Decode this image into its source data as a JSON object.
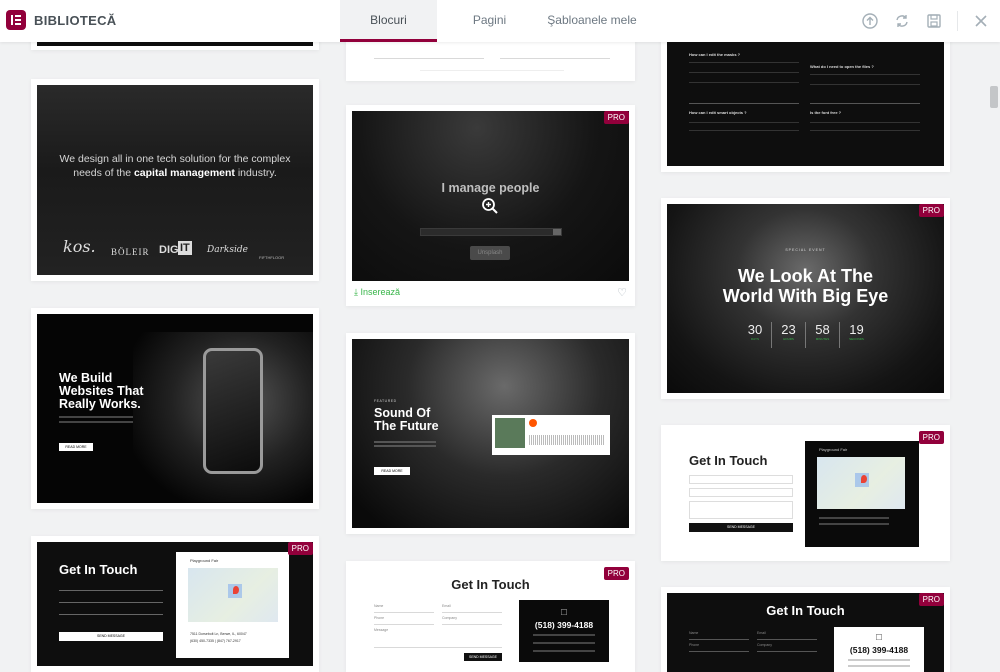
{
  "header": {
    "title": "BIBLIOTECĂ",
    "tabs": [
      {
        "label": "Blocuri",
        "active": true
      },
      {
        "label": "Pagini",
        "active": false
      },
      {
        "label": "Şabloanele mele",
        "active": false
      }
    ],
    "icons": [
      "upload-icon",
      "sync-icon",
      "save-icon",
      "close-icon"
    ]
  },
  "colors": {
    "accent": "#92003b",
    "insert": "#39b54a",
    "background": "#f1f2f3"
  },
  "cards": {
    "tech": {
      "headline_1": "We design all in one tech solution for the complex",
      "headline_2_pre": "needs of the ",
      "headline_2_bold": "capital management",
      "headline_2_post": " industry.",
      "logos": [
        "kos.",
        "BÖLEIR",
        "DIG",
        "IT",
        "Darkside",
        "FIFTHFLOOR"
      ]
    },
    "manage": {
      "title": "I manage people",
      "badge": "PRO",
      "insert_label": "Inserează",
      "watermark": "Unsplash"
    },
    "faq": {
      "questions": [
        "How can I edit the masks ?",
        "What do I need to open the files ?",
        "How can I edit smart objects ?",
        "Is the font free ?"
      ]
    },
    "phone": {
      "title_lines": [
        "We Build",
        "Websites That",
        "Really Works."
      ],
      "button": "READ MORE"
    },
    "future": {
      "eyebrow": "FEATURED",
      "title_lines": [
        "Sound Of",
        "The Future"
      ],
      "button": "READ MORE"
    },
    "event": {
      "badge": "PRO",
      "eyebrow": "SPECIAL EVENT",
      "title_lines": [
        "We Look At The",
        "World With Big Eye"
      ],
      "countdown": [
        {
          "value": "30",
          "unit": "DAYS"
        },
        {
          "value": "23",
          "unit": "HOURS"
        },
        {
          "value": "58",
          "unit": "MINUTES"
        },
        {
          "value": "19",
          "unit": "SECONDS"
        }
      ]
    },
    "contact_white_right": {
      "badge": "PRO",
      "title": "Get In Touch",
      "button": "SEND MESSAGE",
      "map_label": "Playground Fair"
    },
    "contact_dark_left": {
      "badge": "PRO",
      "title": "Get In Touch",
      "button": "SEND MESSAGE",
      "map_label": "Playground Fair",
      "address": "7511 Dorsebolt Ln, Berwe, IL, 60047",
      "phone": "(630) 450-7335 | (847) 767-2917"
    },
    "contact_white_mid": {
      "badge": "PRO",
      "title": "Get In Touch",
      "phone": "(518) 399-4188",
      "button": "SEND MESSAGE",
      "fields": [
        "Name",
        "Email",
        "Phone",
        "Company",
        "Message"
      ]
    },
    "contact_dark_right": {
      "badge": "PRO",
      "title": "Get In Touch",
      "phone": "(518) 399-4188",
      "fields": [
        "Name",
        "Email",
        "Phone",
        "Company"
      ]
    }
  }
}
